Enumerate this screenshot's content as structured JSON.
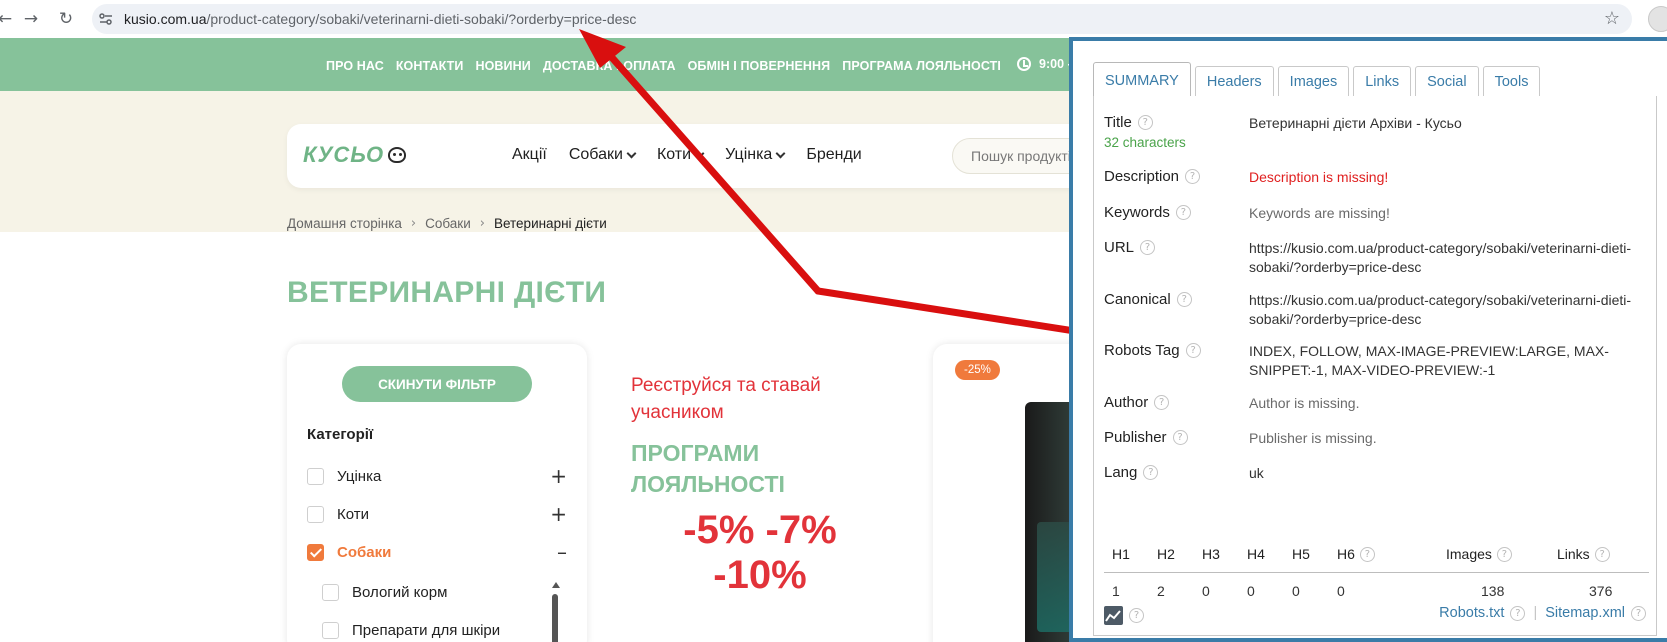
{
  "browser": {
    "url_host": "kusio.com.ua",
    "url_path": "/product-category/sobaki/veterinarni-dieti-sobaki/?orderby=price-desc"
  },
  "topbar": {
    "links": [
      "ПРО НАС",
      "КОНТАКТИ",
      "НОВИНИ",
      "ДОСТАВКА І ОПЛАТА",
      "ОБМІН І ПОВЕРНЕННЯ",
      "ПРОГРАМА ЛОЯЛЬНОСТІ"
    ],
    "hours": "9:00 -"
  },
  "header": {
    "logo_text": "КУСЬО",
    "nav": [
      {
        "label": "Акції",
        "dropdown": false
      },
      {
        "label": "Собаки",
        "dropdown": true
      },
      {
        "label": "Коти",
        "dropdown": true
      },
      {
        "label": "Уцінка",
        "dropdown": true
      },
      {
        "label": "Бренди",
        "dropdown": false
      }
    ],
    "search_placeholder": "Пошук продуктів"
  },
  "breadcrumb": [
    "Домашня сторінка",
    "Собаки",
    "Ветеринарні дієти"
  ],
  "page_title": "ВЕТЕРИНАРНІ ДІЄТИ",
  "filter": {
    "reset_label": "СКИНУТИ ФІЛЬТР",
    "categories_heading": "Категорії",
    "categories": [
      {
        "label": "Уцінка",
        "checked": false,
        "toggle": "+"
      },
      {
        "label": "Коти",
        "checked": false,
        "toggle": "+"
      },
      {
        "label": "Собаки",
        "checked": true,
        "toggle": "–"
      }
    ],
    "subcategories": [
      "Вологий корм",
      "Препарати для шкіри"
    ]
  },
  "promo": {
    "line1": "Реєструйся та ставай учасником",
    "line2": "ПРОГРАМИ ЛОЯЛЬНОСТІ",
    "line3": "-5% -7% -10%"
  },
  "product": {
    "discount_badge": "-25%"
  },
  "seo": {
    "tabs": [
      "SUMMARY",
      "Headers",
      "Images",
      "Links",
      "Social",
      "Tools"
    ],
    "active_tab": "SUMMARY",
    "rows": {
      "title_label": "Title",
      "title_sub": "32 characters",
      "title_value": "Ветеринарні дієти Архіви - Кусьо",
      "description_label": "Description",
      "description_value": "Description is missing!",
      "keywords_label": "Keywords",
      "keywords_value": "Keywords are missing!",
      "url_label": "URL",
      "url_value": "https://kusio.com.ua/product-category/sobaki/veterinarni-dieti-sobaki/?orderby=price-desc",
      "canonical_label": "Canonical",
      "canonical_value": "https://kusio.com.ua/product-category/sobaki/veterinarni-dieti-sobaki/?orderby=price-desc",
      "robots_label": "Robots Tag",
      "robots_value": "INDEX, FOLLOW, MAX-IMAGE-PREVIEW:LARGE, MAX-SNIPPET:-1, MAX-VIDEO-PREVIEW:-1",
      "author_label": "Author",
      "author_value": "Author is missing.",
      "publisher_label": "Publisher",
      "publisher_value": "Publisher is missing.",
      "lang_label": "Lang",
      "lang_value": "uk"
    },
    "headings_table": {
      "headers": [
        "H1",
        "H2",
        "H3",
        "H4",
        "H5",
        "H6",
        "Images",
        "Links"
      ],
      "values": [
        "1",
        "2",
        "0",
        "0",
        "0",
        "0",
        "138",
        "376"
      ]
    },
    "footer": {
      "robots_link": "Robots.txt",
      "sitemap_link": "Sitemap.xml"
    },
    "accent_color": "#3a7ca8",
    "error_color": "#e02020"
  },
  "annotation_color": "#d90f0f"
}
